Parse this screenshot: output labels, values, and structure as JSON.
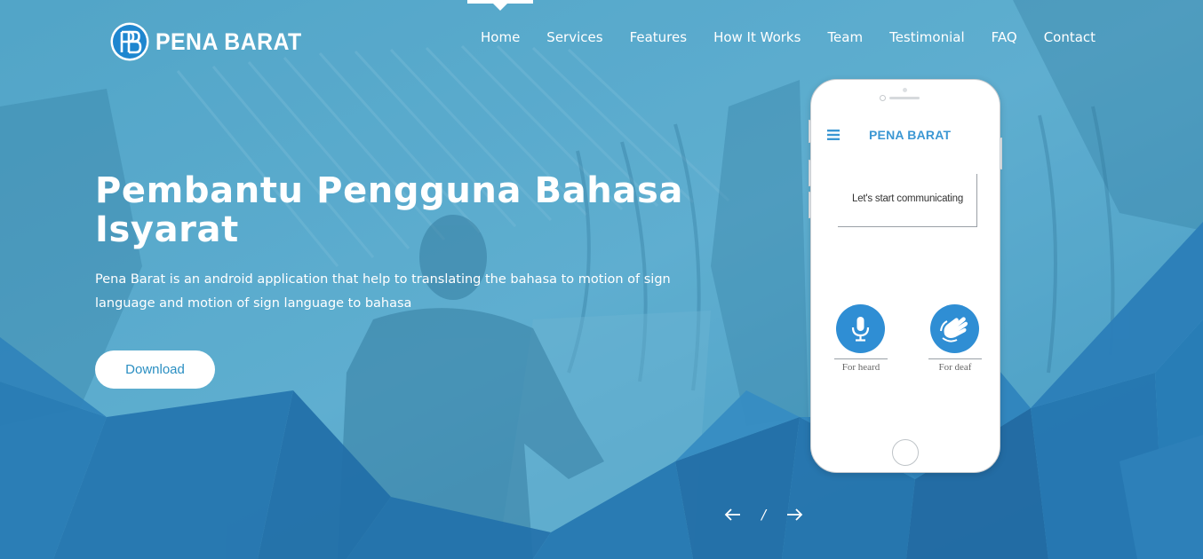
{
  "brand": {
    "name": "PENA BARAT",
    "logo_monogram": "PB"
  },
  "nav": {
    "active_index": 0,
    "items": [
      {
        "label": "Home"
      },
      {
        "label": "Services"
      },
      {
        "label": "Features"
      },
      {
        "label": "How It Works"
      },
      {
        "label": "Team"
      },
      {
        "label": "Testimonial"
      },
      {
        "label": "FAQ"
      },
      {
        "label": "Contact"
      }
    ]
  },
  "hero": {
    "title": "Pembantu Pengguna Bahasa Isyarat",
    "description": "Pena Barat is an android application that help to translating the bahasa to motion of sign language and motion of sign language to bahasa",
    "cta_label": "Download"
  },
  "phone": {
    "app_title": "PENA BARAT",
    "message": "Let's start communicating",
    "buttons": [
      {
        "label": "For heard",
        "icon": "microphone-icon"
      },
      {
        "label": "For deaf",
        "icon": "sign-language-hand-icon"
      }
    ]
  },
  "slider": {
    "separator": "/",
    "prev_icon": "arrow-left-icon",
    "next_icon": "arrow-right-icon"
  },
  "colors": {
    "accent": "#2f8ed4",
    "app_title": "#3b97d3",
    "cta_text": "#2b8fc2"
  }
}
